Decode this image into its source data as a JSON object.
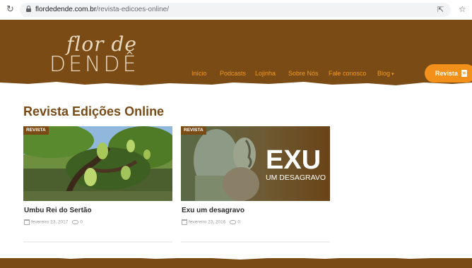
{
  "browser": {
    "url_host": "flordedende.com.br",
    "url_path": "/revista-edicoes-online/",
    "reload_icon": "reload-icon",
    "share_icon": "share-icon",
    "star_icon": "star-icon"
  },
  "site": {
    "logo_script": "flor de",
    "logo_main": "DENDÊ",
    "brand_color": "#7a4b15",
    "accent_color": "#f39019"
  },
  "nav": {
    "items": [
      {
        "label": "Início"
      },
      {
        "label": "Podcasts"
      },
      {
        "label": "Lojinha"
      },
      {
        "label": "Sobre Nós"
      },
      {
        "label": "Fale conosco"
      },
      {
        "label": "Blog"
      }
    ],
    "cta_label": "Revista"
  },
  "main": {
    "title": "Revista Edições Online",
    "cards": [
      {
        "badge": "REVISTA",
        "title": "Umbu Rei do Sertão",
        "date": "fevereiro 23, 2017",
        "comments": "0"
      },
      {
        "badge": "REVISTA",
        "title": "Exu um desagravo",
        "date": "fevereiro 23, 2016",
        "comments": "0",
        "image_text_big": "EXU",
        "image_text_small": "UM DESAGRAVO"
      }
    ]
  }
}
